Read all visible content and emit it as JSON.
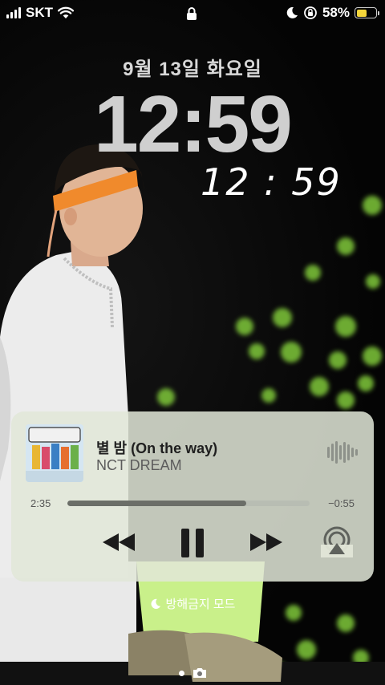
{
  "status_bar": {
    "carrier": "SKT",
    "battery_percent": "58%",
    "battery_level": 0.58,
    "battery_color": "#f5d63b"
  },
  "lock_screen": {
    "date": "9월 13일 화요일",
    "time": "12:59",
    "handwritten_time": "12 : 59"
  },
  "now_playing": {
    "title": "별 밤 (On the way)",
    "artist": "NCT DREAM",
    "elapsed": "2:35",
    "remaining": "−0:55",
    "progress": 0.74
  },
  "focus_mode": {
    "label": "방해금지 모드"
  },
  "colors": {
    "accent_green": "#7fc83a",
    "card_bg": "#e1e6d7"
  }
}
